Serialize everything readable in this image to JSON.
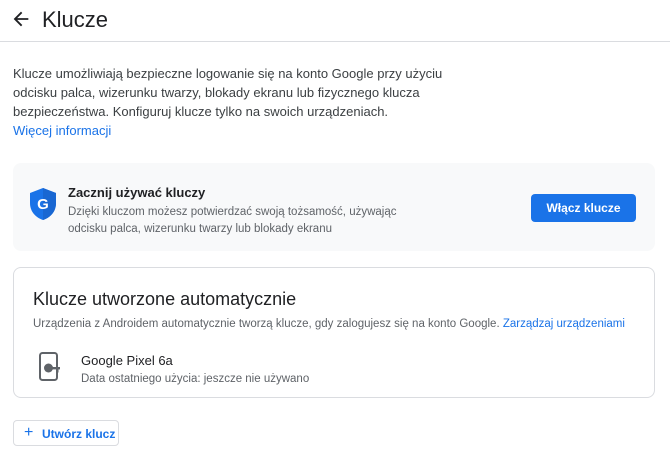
{
  "header": {
    "title": "Klucze",
    "back_icon": "arrow-back-icon"
  },
  "intro": {
    "text": "Klucze umożliwiają bezpieczne logowanie się na konto Google przy użyciu odcisku palca, wizerunku twarzy, blokady ekranu lub fizycznego klucza bez­pieczeństwa. Konfiguruj klucze tylko na swoich urządzeniach.",
    "more_link": "Więcej informacji"
  },
  "promo": {
    "icon": "google-shield-icon",
    "title": "Zacznij używać kluczy",
    "description": "Dzięki kluczom możesz potwierdzać swoją tożsamość, używając odcisku palca, wizerunku twarzy lub blokady ekranu",
    "button_label": "Włącz klucze"
  },
  "auto_keys": {
    "title": "Klucze utworzone automatycznie",
    "description": "Urządzenia z Androidem automatycznie tworzą klucze, gdy zalogujesz się na konto Google.",
    "manage_link": "Zarządzaj urządzeniami",
    "device": {
      "icon": "phone-key-icon",
      "name": "Google Pixel 6a",
      "last_used": "Data ostatniego użycia: jeszcze nie używano"
    }
  },
  "create": {
    "icon": "plus-icon",
    "label": "Utwórz klucz",
    "plus_glyph": "+"
  },
  "colors": {
    "accent": "#1a73e8",
    "text": "#202124",
    "secondary": "#5f6368",
    "border": "#dadce0",
    "card_bg": "#f8f9fa"
  }
}
